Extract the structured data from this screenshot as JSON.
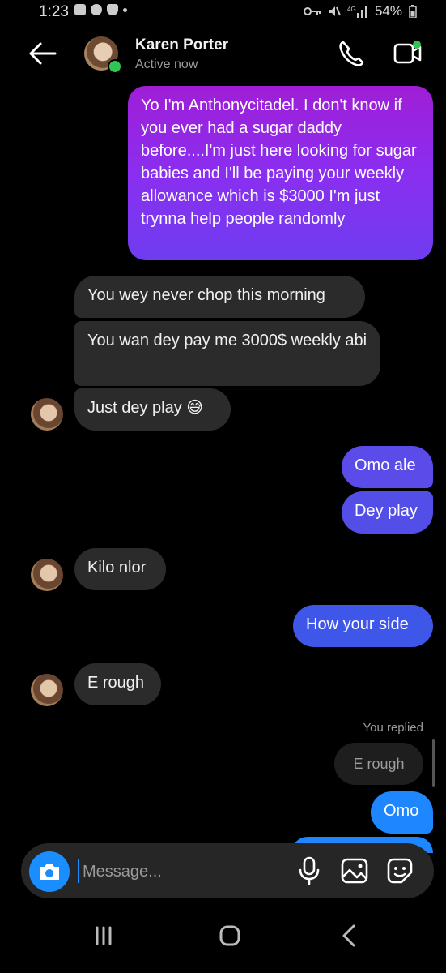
{
  "status_bar": {
    "time": "1:23",
    "battery": "54%"
  },
  "header": {
    "name": "Karen Porter",
    "status": "Active now"
  },
  "messages": {
    "m1": "Yo I'm Anthonycitadel. I don't know if you ever had a sugar daddy before....I'm just here looking for sugar babies and I'll be paying your weekly allowance which is $3000 I'm just trynna help people randomly",
    "m2": "You wey never chop this morning",
    "m3": "You wan dey pay me 3000$ weekly abi",
    "m4": "Just dey play 😅",
    "m5": "Omo ale",
    "m6": "Dey play",
    "m7": "Kilo nlor",
    "m8": "How your side",
    "m9": "E rough",
    "replied_label": "You replied",
    "replied_quote": "E rough",
    "m10": "Omo"
  },
  "composer": {
    "placeholder": "Message..."
  },
  "colors": {
    "accent_blue": "#1a8dff",
    "sent_blue": "#3f57e8",
    "received_bubble": "#2b2b2b",
    "gradient_top": "#a01ed6",
    "online": "#31c553"
  }
}
